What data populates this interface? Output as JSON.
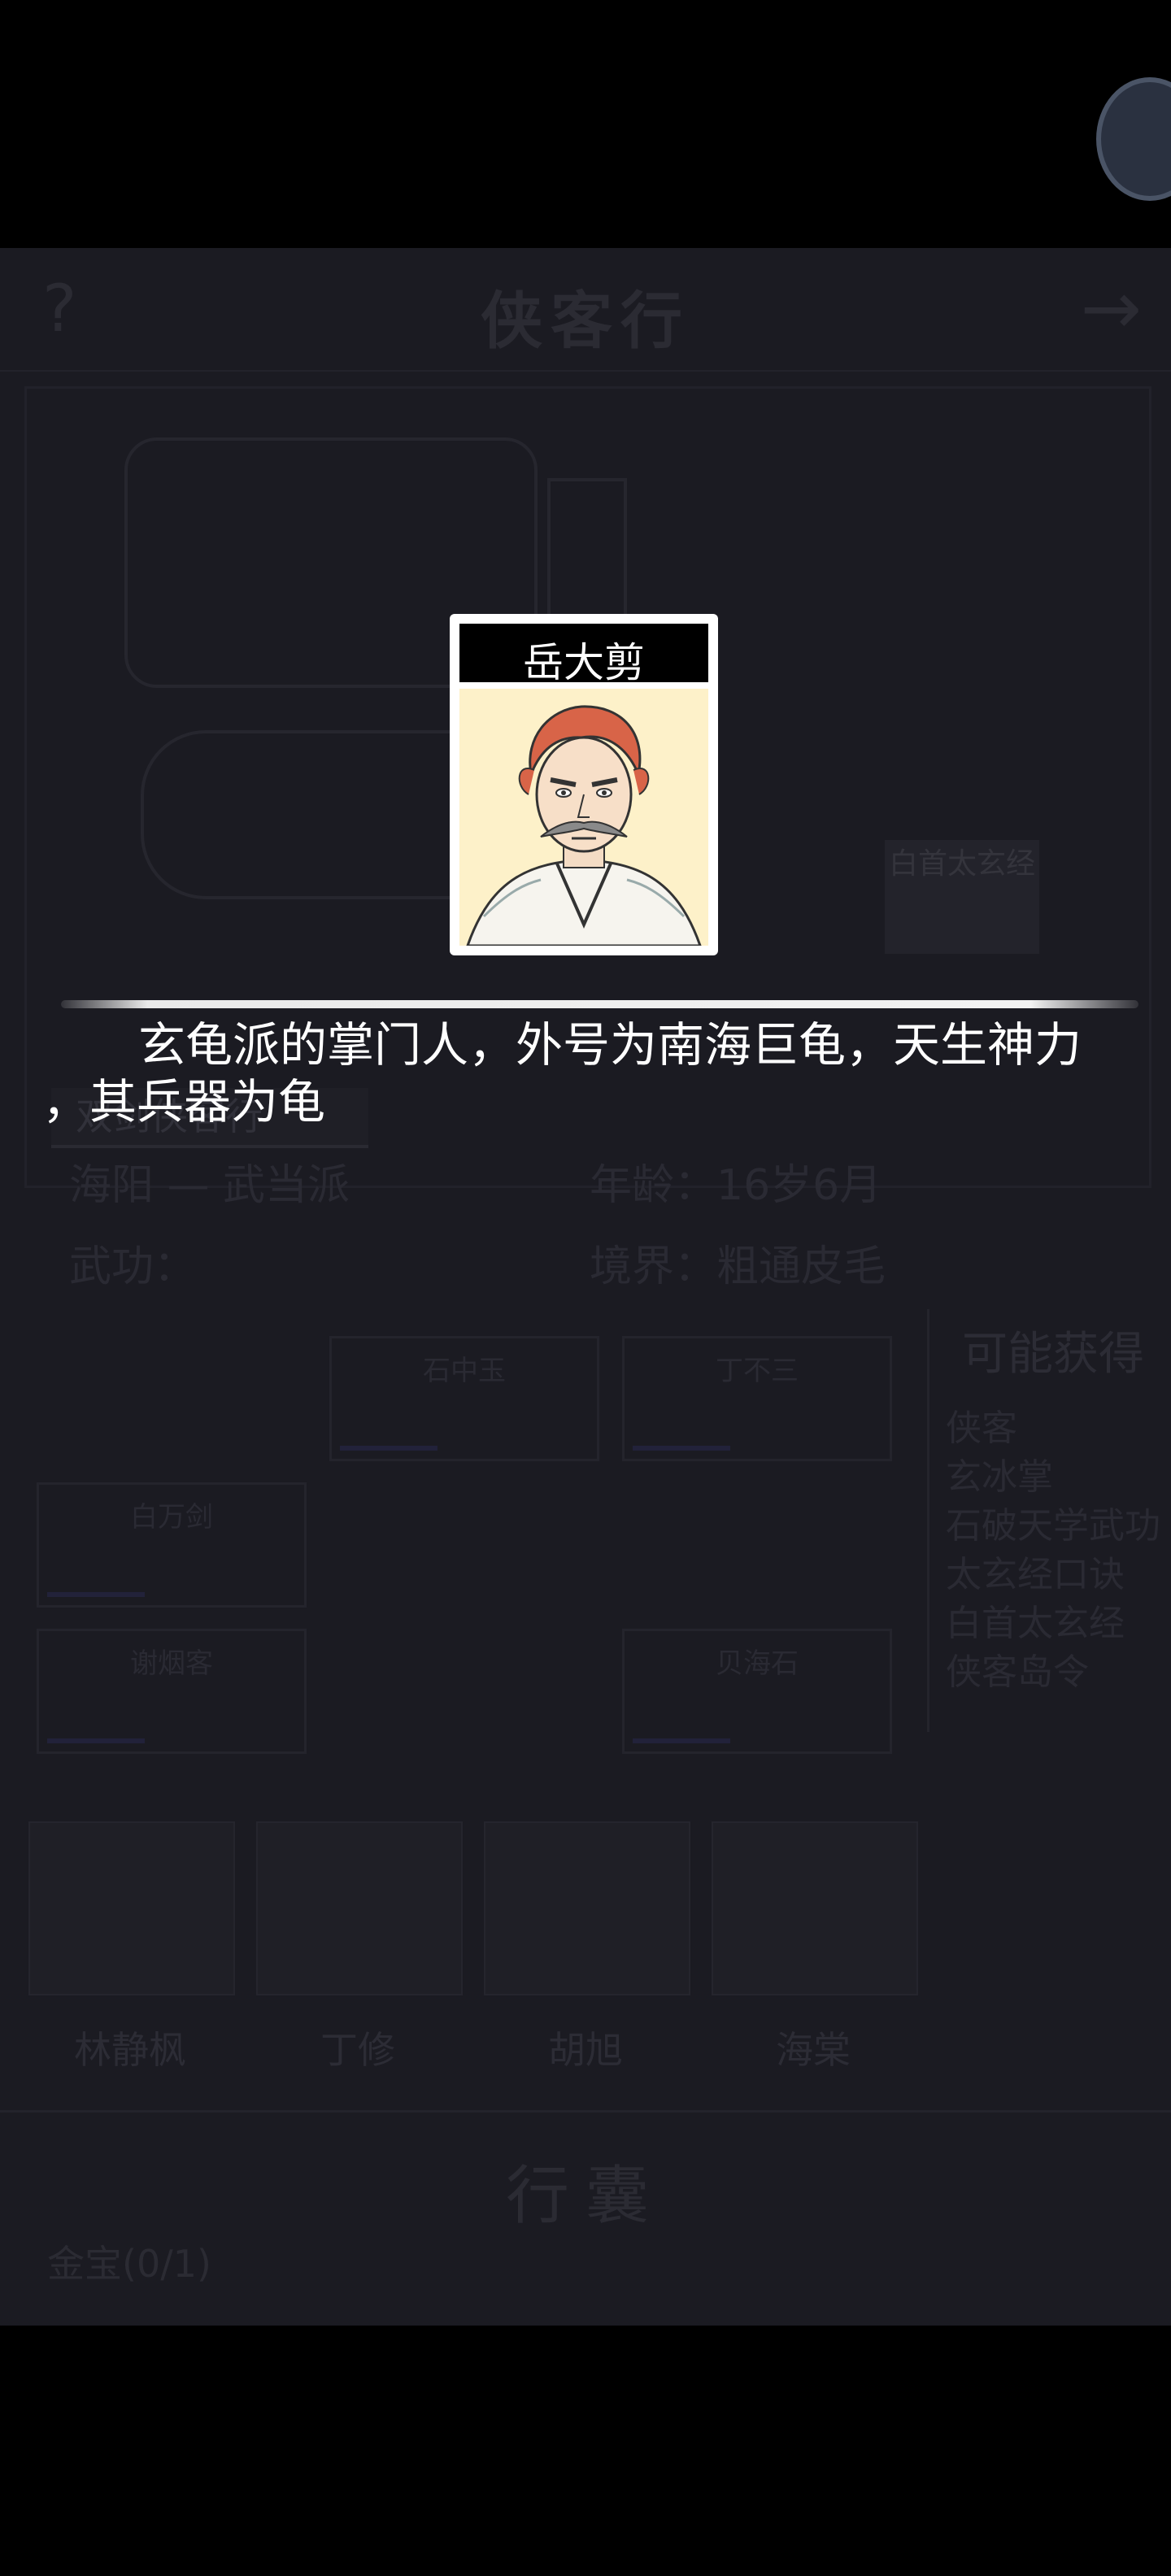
{
  "background": {
    "header": {
      "title": "侠客行",
      "help_icon": "question-mark",
      "next_icon": "arrow-right"
    },
    "scene": {
      "sign_text": "白首太玄经",
      "ribbon_text": "双剑侠客行"
    },
    "info": {
      "location": "海阳 — 武当派",
      "age": "年龄：16岁6月",
      "skills": "武功：",
      "realm": "境界：粗通皮毛"
    },
    "slots": [
      {
        "name": "石中玉"
      },
      {
        "name": "丁不三"
      },
      {
        "name": "白万剑"
      },
      {
        "name": "谢烟客"
      },
      {
        "name": "贝海石"
      }
    ],
    "gain_title": "可能获得",
    "gain_rows": [
      "侠客",
      "玄冰掌",
      "石破天学武功",
      "太玄经口诀",
      "白首太玄经",
      "侠客岛令"
    ],
    "companions": [
      "林静枫",
      "丁修",
      "胡旭",
      "海棠"
    ],
    "bag": {
      "title": "行囊",
      "count": "金宝(0/1)"
    }
  },
  "popup": {
    "name": "岳大剪",
    "description_line1": "玄龟派的掌门人，外号为南海巨龟，天生神力",
    "description_line2": "，其兵器为龟",
    "colors": {
      "card_bg": "#fdf1c9",
      "name_bar": "#000000",
      "text": "#ffffff"
    }
  }
}
